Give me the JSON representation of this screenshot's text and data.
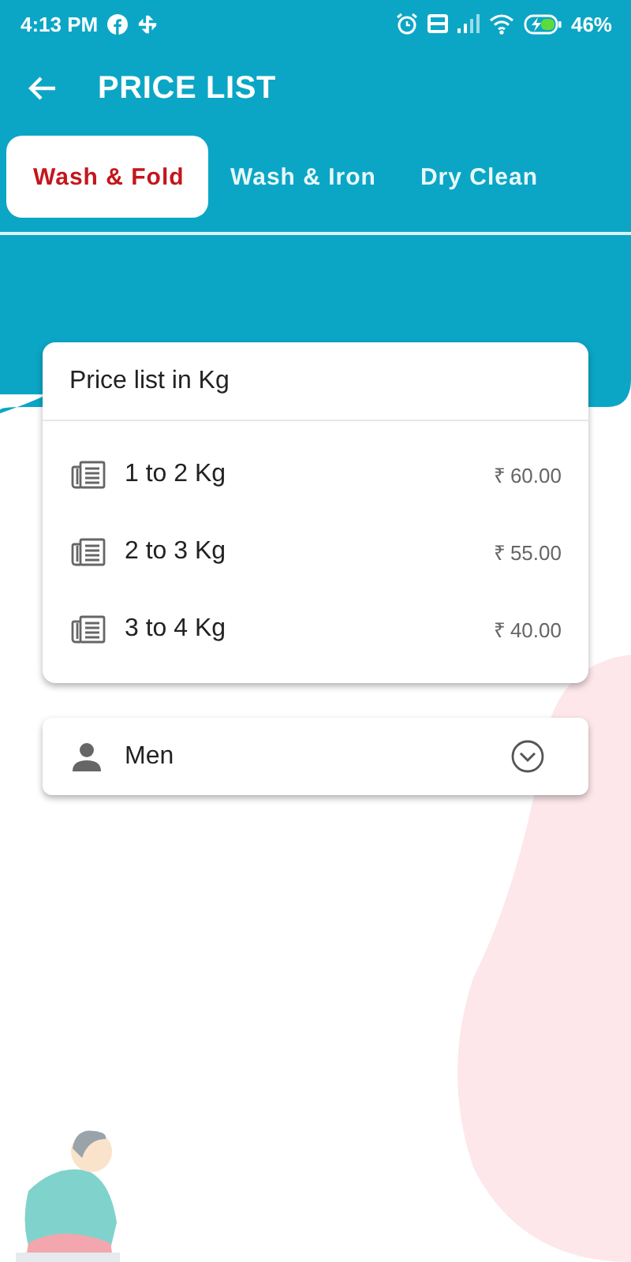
{
  "status_bar": {
    "time": "4:13 PM",
    "battery": "46%"
  },
  "app_bar": {
    "title": "PRICE LIST"
  },
  "tabs": [
    {
      "label": "Wash & Fold",
      "selected": true
    },
    {
      "label": "Wash & Iron",
      "selected": false
    },
    {
      "label": "Dry Clean",
      "selected": false
    }
  ],
  "price_card": {
    "title": "Price list in Kg",
    "rows": [
      {
        "range": "1 to 2 Kg",
        "price": "₹ 60.00"
      },
      {
        "range": "2 to 3 Kg",
        "price": "₹ 55.00"
      },
      {
        "range": "3 to 4 Kg",
        "price": "₹ 40.00"
      }
    ]
  },
  "category_select": {
    "value": "Men"
  }
}
